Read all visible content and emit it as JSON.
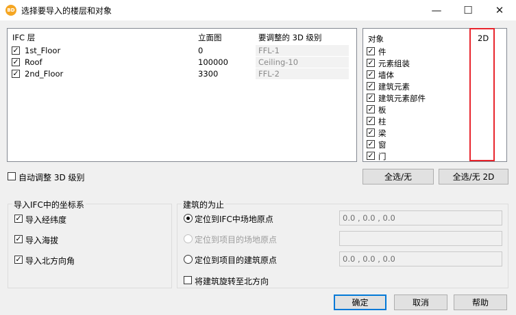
{
  "window": {
    "title": "选择要导入的楼层和对象",
    "app_icon": "BD",
    "minimize_glyph": "—",
    "maximize_glyph": "☐",
    "close_glyph": "✕"
  },
  "levels_table": {
    "headers": [
      "IFC 层",
      "立面图",
      "要调整的 3D 级别"
    ],
    "rows": [
      {
        "name": "1st_Floor",
        "elevation": "0",
        "level": "FFL-1",
        "checked": true
      },
      {
        "name": "Roof",
        "elevation": "100000",
        "level": "Ceiling-10",
        "checked": true
      },
      {
        "name": "2nd_Floor",
        "elevation": "3300",
        "level": "FFL-2",
        "checked": true
      }
    ]
  },
  "objects_table": {
    "header_object": "对象",
    "header_2d": "2D",
    "items": [
      "件",
      "元素组装",
      "墙体",
      "建筑元素",
      "建筑元素部件",
      "板",
      "柱",
      "梁",
      "窗",
      "门"
    ]
  },
  "auto_adjust": {
    "label": "自动调整 3D 级别",
    "checked": false
  },
  "select_all_button": "全选/无",
  "select_all_2d_button": "全选/无 2D",
  "coordinate_group": {
    "title": "导入IFC中的坐标系",
    "options": [
      {
        "label": "导入经纬度",
        "checked": true
      },
      {
        "label": "导入海拔",
        "checked": true
      },
      {
        "label": "导入北方向角",
        "checked": true
      }
    ]
  },
  "building_group": {
    "title": "建筑的为止",
    "options": [
      {
        "label": "定位到IFC中场地原点",
        "selected": true,
        "enabled": true,
        "value": "0.0 , 0.0 , 0.0"
      },
      {
        "label": "定位到项目的场地原点",
        "selected": false,
        "enabled": false,
        "value": ""
      },
      {
        "label": "定位到项目的建筑原点",
        "selected": false,
        "enabled": true,
        "value": "0.0 , 0.0 , 0.0"
      }
    ],
    "rotate": {
      "label": "将建筑旋转至北方向",
      "checked": false
    }
  },
  "footer": {
    "ok": "确定",
    "cancel": "取消",
    "help": "帮助"
  },
  "check_glyph": "✓",
  "colors": {
    "highlight": "#e8232b",
    "accent": "#0078d7"
  }
}
